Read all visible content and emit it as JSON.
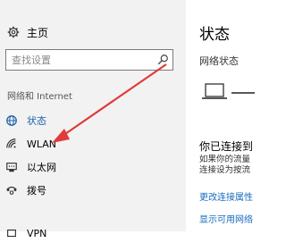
{
  "sidebar": {
    "home_label": "主页",
    "search_placeholder": "查找设置",
    "section_title": "网络和 Internet",
    "items": [
      {
        "label": "状态",
        "icon": "globe-icon",
        "active": true
      },
      {
        "label": "WLAN",
        "icon": "wifi-icon",
        "active": false
      },
      {
        "label": "以太网",
        "icon": "ethernet-icon",
        "active": false
      },
      {
        "label": "拨号",
        "icon": "dialup-icon",
        "active": false
      },
      {
        "label": "VPN",
        "icon": "vpn-icon",
        "active": false
      }
    ]
  },
  "main": {
    "title": "状态",
    "subtitle": "网络状态",
    "connected_title": "你已连接到",
    "connected_desc_line1": "如果你的流量",
    "connected_desc_line2": "连接设为按流",
    "link_change_props": "更改连接属性",
    "link_show_networks": "显示可用网络"
  },
  "colors": {
    "sidebar_bg": "#f2f2f2",
    "accent": "#1a60a8",
    "link": "#1a6bbf",
    "arrow": "#e03a3a"
  }
}
